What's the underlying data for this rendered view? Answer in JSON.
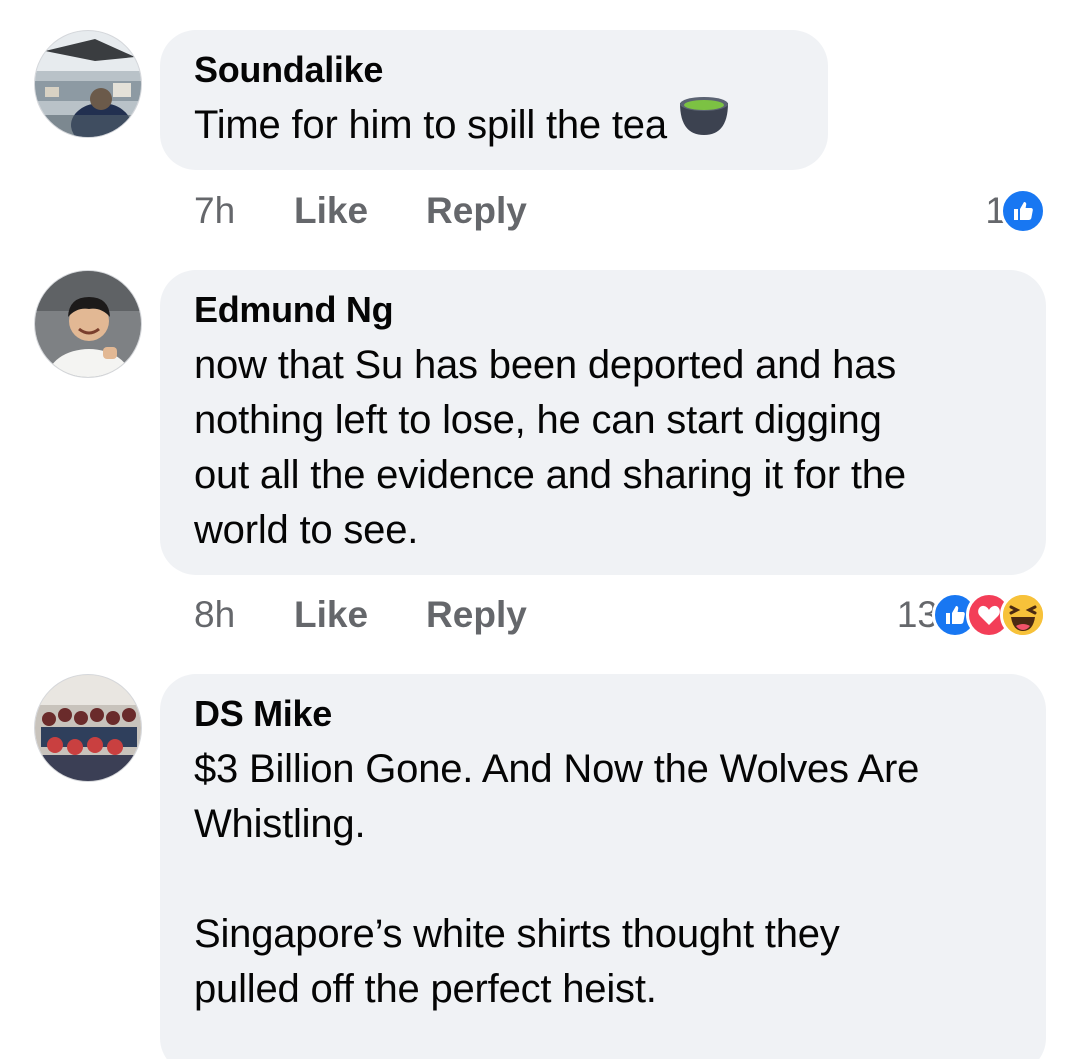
{
  "comments": [
    {
      "author": "Soundalike",
      "text": "Time for him to spill the tea",
      "emoji": "tea-cup-icon",
      "time": "7h",
      "like_label": "Like",
      "reply_label": "Reply",
      "reaction_count": "1",
      "reactions": [
        "like-icon"
      ]
    },
    {
      "author": "Edmund Ng",
      "text": "now that Su has been deported and has\nnothing left to lose, he can start digging\nout all the evidence and sharing it for the\nworld to see.",
      "time": "8h",
      "like_label": "Like",
      "reply_label": "Reply",
      "reaction_count": "13",
      "reactions": [
        "like-icon",
        "love-icon",
        "haha-icon"
      ]
    },
    {
      "author": "DS Mike",
      "text": "$3 Billion Gone. And Now the Wolves Are\nWhistling.\n\nSingapore’s white shirts thought they\npulled off the perfect heist."
    }
  ],
  "colors": {
    "bubble": "#f0f2f5",
    "meta_text": "#65676b",
    "like": "#1877f2",
    "love": "#f33e58",
    "haha": "#f7b125"
  }
}
